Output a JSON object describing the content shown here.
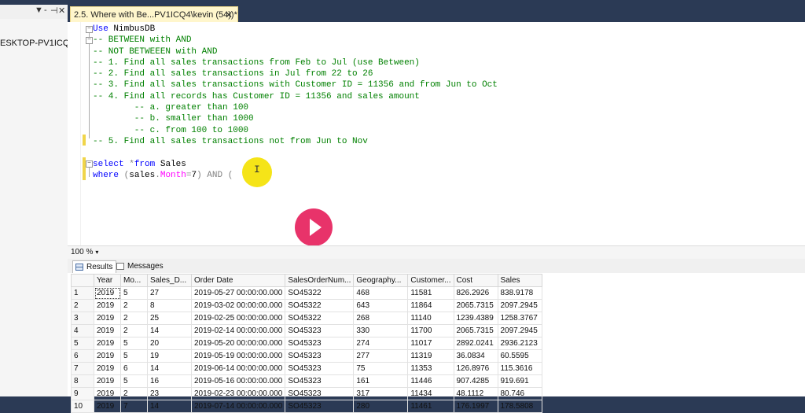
{
  "left_panel": {
    "controls": [
      "▼",
      "‑",
      "⊣",
      "✕"
    ],
    "server_label": "ESKTOP-PV1ICQ4\\"
  },
  "doc_tab": {
    "title": "2.5. Where with Be...PV1ICQ4\\kevin (54))*",
    "close": "✕"
  },
  "editor": {
    "lines": [
      [
        {
          "t": "Use ",
          "c": "kw"
        },
        {
          "t": "NimbusDB",
          "c": "tx"
        }
      ],
      [
        {
          "t": "-- BETWEEN with AND",
          "c": "cm"
        }
      ],
      [
        {
          "t": "-- NOT BETWEEEN with AND",
          "c": "cm"
        }
      ],
      [
        {
          "t": "-- 1. Find all sales transactions from Feb to Jul (use Between)",
          "c": "cm"
        }
      ],
      [
        {
          "t": "-- 2. Find all sales transactions in Jul from 22 to 26",
          "c": "cm"
        }
      ],
      [
        {
          "t": "-- 3. Find all sales transactions with Customer ID = 11356 and from Jun to Oct",
          "c": "cm"
        }
      ],
      [
        {
          "t": "-- 4. Find all records has Customer ID = 11356 and sales amount",
          "c": "cm"
        }
      ],
      [
        {
          "t": "        -- a. greater than 100",
          "c": "cm"
        }
      ],
      [
        {
          "t": "        -- b. smaller than 1000",
          "c": "cm"
        }
      ],
      [
        {
          "t": "        -- c. from 100 to 1000",
          "c": "cm"
        }
      ],
      [
        {
          "t": "-- 5. Find all sales transactions not from Jun to Nov",
          "c": "cm"
        }
      ],
      [],
      [
        {
          "t": "select ",
          "c": "kw"
        },
        {
          "t": "*",
          "c": "gr"
        },
        {
          "t": "from ",
          "c": "kw"
        },
        {
          "t": "Sales",
          "c": "tx"
        }
      ],
      [
        {
          "t": "where ",
          "c": "kw"
        },
        {
          "t": "(",
          "c": "gr"
        },
        {
          "t": "sales",
          "c": "tx"
        },
        {
          "t": ".",
          "c": "gr"
        },
        {
          "t": "Month",
          "c": "pk"
        },
        {
          "t": "=",
          "c": "gr"
        },
        {
          "t": "7",
          "c": "tx"
        },
        {
          "t": ") ",
          "c": "gr"
        },
        {
          "t": "AND ",
          "c": "gr"
        },
        {
          "t": "(",
          "c": "gr"
        }
      ]
    ],
    "cursor_glyph": "I"
  },
  "status": {
    "zoom": "100 %",
    "zoom_arrow": "▾"
  },
  "results_tabs": [
    {
      "label": "Results",
      "active": true,
      "icon": "grid-icon"
    },
    {
      "label": "Messages",
      "active": false,
      "icon": "message-icon"
    }
  ],
  "grid": {
    "columns": [
      "Year",
      "Mo...",
      "Sales_D...",
      "Order Date",
      "SalesOrderNum...",
      "Geography...",
      "Customer...",
      "Cost",
      "Sales"
    ],
    "rows": [
      [
        "1",
        "2019",
        "5",
        "27",
        "2019-05-27 00:00:00.000",
        "SO45322",
        "468",
        "11581",
        "826.2926",
        "838.9178"
      ],
      [
        "2",
        "2019",
        "2",
        "8",
        "2019-03-02 00:00:00.000",
        "SO45322",
        "643",
        "11864",
        "2065.7315",
        "2097.2945"
      ],
      [
        "3",
        "2019",
        "2",
        "25",
        "2019-02-25 00:00:00.000",
        "SO45322",
        "268",
        "11140",
        "1239.4389",
        "1258.3767"
      ],
      [
        "4",
        "2019",
        "2",
        "14",
        "2019-02-14 00:00:00.000",
        "SO45323",
        "330",
        "11700",
        "2065.7315",
        "2097.2945"
      ],
      [
        "5",
        "2019",
        "5",
        "20",
        "2019-05-20 00:00:00.000",
        "SO45323",
        "274",
        "11017",
        "2892.0241",
        "2936.2123"
      ],
      [
        "6",
        "2019",
        "5",
        "19",
        "2019-05-19 00:00:00.000",
        "SO45323",
        "277",
        "11319",
        "36.0834",
        "60.5595"
      ],
      [
        "7",
        "2019",
        "6",
        "14",
        "2019-06-14 00:00:00.000",
        "SO45323",
        "75",
        "11353",
        "126.8976",
        "115.3616"
      ],
      [
        "8",
        "2019",
        "5",
        "16",
        "2019-05-16 00:00:00.000",
        "SO45323",
        "161",
        "11446",
        "907.4285",
        "919.691"
      ],
      [
        "9",
        "2019",
        "2",
        "23",
        "2019-02-23 00:00:00.000",
        "SO45323",
        "317",
        "11434",
        "48.1112",
        "80.746"
      ],
      [
        "10",
        "2019",
        "7",
        "14",
        "2019-07-14 00:00:00.000",
        "SO45323",
        "280",
        "11461",
        "176.1997",
        "178.5808"
      ]
    ]
  }
}
